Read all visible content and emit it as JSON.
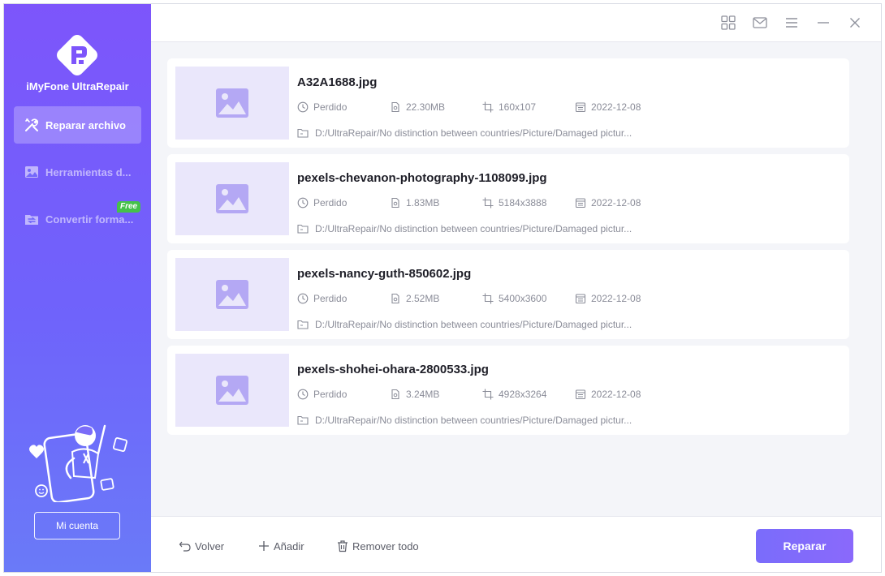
{
  "app": {
    "name": "iMyFone UltraRepair",
    "brand_color": "#7d55fb",
    "accent_color": "#7a6cfb"
  },
  "sidebar": {
    "items": [
      {
        "label": "Reparar archivo",
        "icon": "repair-tools-icon",
        "active": true
      },
      {
        "label": "Herramientas d...",
        "icon": "image-tools-icon",
        "active": false
      },
      {
        "label": "Convertir forma...",
        "icon": "convert-icon",
        "active": false
      }
    ],
    "free_badge": "Free",
    "account_label": "Mi cuenta"
  },
  "titlebar": {
    "icons": [
      "grid-icon",
      "mail-icon",
      "menu-icon",
      "minimize-icon",
      "close-icon"
    ]
  },
  "files": [
    {
      "name": "A32A1688.jpg",
      "status": "Perdido",
      "size": "22.30MB",
      "dimensions": "160x107",
      "date": "2022-12-08",
      "path": "D:/UltraRepair/No distinction between countries/Picture/Damaged pictur..."
    },
    {
      "name": "pexels-chevanon-photography-1108099.jpg",
      "status": "Perdido",
      "size": "1.83MB",
      "dimensions": "5184x3888",
      "date": "2022-12-08",
      "path": "D:/UltraRepair/No distinction between countries/Picture/Damaged pictur..."
    },
    {
      "name": "pexels-nancy-guth-850602.jpg",
      "status": "Perdido",
      "size": "2.52MB",
      "dimensions": "5400x3600",
      "date": "2022-12-08",
      "path": "D:/UltraRepair/No distinction between countries/Picture/Damaged pictur..."
    },
    {
      "name": "pexels-shohei-ohara-2800533.jpg",
      "status": "Perdido",
      "size": "3.24MB",
      "dimensions": "4928x3264",
      "date": "2022-12-08",
      "path": "D:/UltraRepair/No distinction between countries/Picture/Damaged pictur..."
    }
  ],
  "footer": {
    "back_label": "Volver",
    "add_label": "Añadir",
    "remove_all_label": "Remover todo",
    "repair_label": "Reparar"
  }
}
